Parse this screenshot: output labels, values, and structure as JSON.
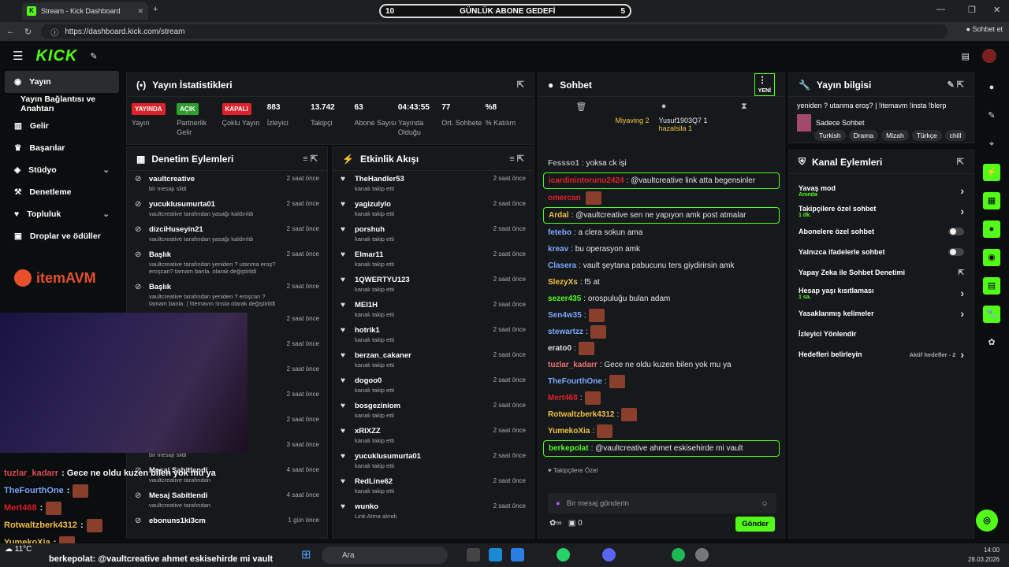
{
  "browser": {
    "tab_title": "Stream - Kick Dashboard",
    "url": "https://dashboard.kick.com/stream",
    "copilot": "Sohbet et"
  },
  "goal": {
    "left": "10",
    "title": "GÜNLÜK ABONE GEDEFİ",
    "right": "5"
  },
  "sidebar": {
    "items": [
      {
        "label": "Yayın"
      },
      {
        "label": "Yayın Bağlantısı ve Anahtarı"
      },
      {
        "label": "Gelir"
      },
      {
        "label": "Başarılar"
      },
      {
        "label": "Stüdyo"
      },
      {
        "label": "Denetleme"
      },
      {
        "label": "Topluluk"
      },
      {
        "label": "Droplar ve ödüller"
      }
    ],
    "brand": "itemAVM"
  },
  "stats": {
    "title": "Yayın İstatistikleri",
    "items": [
      {
        "value": "YAYINDA",
        "label": "Yayın",
        "color": "#e0202a"
      },
      {
        "value": "AÇIK",
        "label": "Partnerlik Gelir",
        "color": "#2e9e2e"
      },
      {
        "value": "KAPALI",
        "label": "Çoklu Yayın",
        "color": "#e0202a"
      },
      {
        "value": "883",
        "label": "İzleyici"
      },
      {
        "value": "13.742",
        "label": "Takipçi"
      },
      {
        "value": "63",
        "label": "Abone Sayısı"
      },
      {
        "value": "04:43:55",
        "label": "Yayında Olduğu"
      },
      {
        "value": "77",
        "label": "Ort. Sohbete"
      },
      {
        "value": "%8",
        "label": "% Katılım"
      }
    ]
  },
  "moderation": {
    "title": "Denetim Eylemleri",
    "rows": [
      {
        "name": "vaultcreative",
        "desc": "bir mesajı sildi",
        "time": "2 saat önce"
      },
      {
        "name": "yucuklusumurta01",
        "desc": "vaultcreative tarafından yasağı kaldırıldı",
        "time": "2 saat önce"
      },
      {
        "name": "dizciHuseyin21",
        "desc": "vaultcreative tarafından yasağı kaldırıldı",
        "time": "2 saat önce"
      },
      {
        "name": "Başlık",
        "desc": "vaultcreative tarafından yeniden ? utanma eroş? eroşcan? tamam banla. olarak değiştirildi",
        "time": "2 saat önce"
      },
      {
        "name": "Başlık",
        "desc": "vaultcreative tarafından yeniden ? eroşcan ? tamam banla. | !itemavm !insta olarak değiştirildi",
        "time": "2 saat önce"
      },
      {
        "name": "",
        "desc": "ıldı",
        "time": "2 saat önce"
      },
      {
        "name": "",
        "desc": "ıldı",
        "time": "2 saat önce"
      },
      {
        "name": "",
        "desc": "eliğine sohbetten",
        "time": "2 saat önce"
      },
      {
        "name": "",
        "desc": "ıldı",
        "time": "2 saat önce"
      },
      {
        "name": "",
        "desc": "ıldı",
        "time": "2 saat önce"
      },
      {
        "name": "vaultcreative",
        "desc": "bir mesajı sildi",
        "time": "3 saat önce"
      },
      {
        "name": "Mesaj Sabitlendi",
        "desc": "vaultcreative tarafından",
        "time": "4 saat önce"
      },
      {
        "name": "Mesaj Sabitlendi",
        "desc": "vaultcreative tarafından",
        "time": "4 saat önce"
      },
      {
        "name": "ebonuns1ki3cm",
        "desc": "",
        "time": "1 gün önce"
      }
    ]
  },
  "activity": {
    "title": "Etkinlik Akışı",
    "rows": [
      {
        "name": "TheHandler53",
        "desc": "kanalı takip etti",
        "time": "2 saat önce"
      },
      {
        "name": "yagizulylo",
        "desc": "kanalı takip etti",
        "time": "2 saat önce"
      },
      {
        "name": "porshuh",
        "desc": "kanalı takip etti",
        "time": "2 saat önce"
      },
      {
        "name": "Elmar11",
        "desc": "kanalı takip etti",
        "time": "2 saat önce"
      },
      {
        "name": "1QWERTYU123",
        "desc": "kanalı takip etti",
        "time": "2 saat önce"
      },
      {
        "name": "MEI1H",
        "desc": "kanalı takip etti",
        "time": "2 saat önce"
      },
      {
        "name": "hotrik1",
        "desc": "kanalı takip etti",
        "time": "2 saat önce"
      },
      {
        "name": "berzan_cakaner",
        "desc": "kanalı takip etti",
        "time": "2 saat önce"
      },
      {
        "name": "dogoo0",
        "desc": "kanalı takip etti",
        "time": "2 saat önce"
      },
      {
        "name": "bosgeziniom",
        "desc": "kanalı takip etti",
        "time": "2 saat önce"
      },
      {
        "name": "xRIXZZ",
        "desc": "kanalı takip etti",
        "time": "2 saat önce"
      },
      {
        "name": "yucuklusumurta01",
        "desc": "kanalı takip etti",
        "time": "2 saat önce"
      },
      {
        "name": "RedLine62",
        "desc": "kanalı takip etti",
        "time": "2 saat önce"
      },
      {
        "name": "wunko",
        "desc": "Link Atma alındı",
        "time": "2 saat önce"
      }
    ]
  },
  "chat": {
    "title": "Sohbet",
    "new": "YENİ",
    "leader1": "Miyaving",
    "leader1b": "2",
    "leader2": "Yusuf1903Q7",
    "leader2b": "1",
    "leader3": "hazalsila",
    "leader3b": "1",
    "messages": [
      {
        "user": "Fessso1",
        "text": ": yoksa ck işi",
        "color": "#aaa"
      },
      {
        "user": "icardinintorunu2424",
        "text": ": @vaultcreative link atta begensinler",
        "color": "#e0202a",
        "hl": true
      },
      {
        "user": "omercan",
        "text": "",
        "color": "#e0202a",
        "emote": true
      },
      {
        "user": "Ardal",
        "text": ": @vaultcreative sen ne yapıyon amk post atmalar",
        "color": "#f0c040",
        "hl": true
      },
      {
        "user": "fetebo",
        "text": ": a     clera sokun ama",
        "color": "#7aa8ff"
      },
      {
        "user": "kreav",
        "text": ": bu     operasyon amk",
        "color": "#7aa8ff"
      },
      {
        "user": "Clasera",
        "text": ": vault şeytana pabucunu ters giydirirsin amk",
        "color": "#7aa8ff"
      },
      {
        "user": "SlezyXs",
        "text": ": f5 at",
        "color": "#f0c040"
      },
      {
        "user": "sezer435",
        "text": ": orospuluğu bulan adam",
        "color": "#53fc18"
      },
      {
        "user": "Sen4w35",
        "text": ":",
        "color": "#7aa8ff",
        "emote": true
      },
      {
        "user": "stewartzz",
        "text": ":",
        "color": "#7aa8ff",
        "emote": true
      },
      {
        "user": "erato0",
        "text": ":",
        "color": "#ddd",
        "emote": true
      },
      {
        "user": "tuzlar_kadarr",
        "text": ": Gece ne oldu kuzen bilen yok mu ya",
        "color": "#f07070"
      },
      {
        "user": "TheFourthOne",
        "text": ":",
        "color": "#7aa8ff",
        "emote": true
      },
      {
        "user": "Mert468",
        "text": ":",
        "color": "#e0202a",
        "emote": true
      },
      {
        "user": "Rotwaltzberk4312",
        "text": ":",
        "color": "#f0c040",
        "emote": true
      },
      {
        "user": "YumekoXia",
        "text": ":",
        "color": "#f0c040",
        "emote": true
      },
      {
        "user": "berkepolat",
        "text": ": @vaultcreative ahmet eskisehirde mi vault",
        "color": "#53fc18",
        "hl": true
      }
    ],
    "followers_only": "Takipçilere Özel",
    "input_placeholder": "Bir mesaj gönderin",
    "count": "0",
    "send": "Gönder"
  },
  "info": {
    "title": "Yayın bilgisi",
    "stream_title": "yeniden ? utanma eroş? | !itemavm !insta !blerp",
    "category": "Sadece Sohbet",
    "tags": [
      "Turkish",
      "Drama",
      "Mizah",
      "Türkçe",
      "chill"
    ]
  },
  "channel": {
    "title": "Kanal Eylemleri",
    "options": [
      {
        "label": "Yavaş mod",
        "sub": "Anında"
      },
      {
        "label": "Takipçilere özel sohbet",
        "sub": "1 dk."
      },
      {
        "label": "Abonelere özel sohbet",
        "sub": ""
      },
      {
        "label": "Yalnızca ifadelerle sohbet",
        "sub": ""
      },
      {
        "label": "Yapay Zeka ile Sohbet Denetimi",
        "sub": ""
      },
      {
        "label": "Hesap yaşı kısıtlaması",
        "sub": "1 sa."
      },
      {
        "label": "Yasaklanmış kelimeler",
        "sub": ""
      },
      {
        "label": "İzleyici Yönlendir",
        "sub": ""
      },
      {
        "label": "Hedefleri belirleyin",
        "sub": ""
      }
    ],
    "goals_active": "Aktif hedefler - 2"
  },
  "overlay": [
    {
      "user": "tuzlar_kadarr",
      "text": ": Gece ne oldu kuzen bilen yok mu ya",
      "color": "#e0505a"
    },
    {
      "user": "TheFourthOne",
      "text": ":",
      "color": "#7aa8ff"
    },
    {
      "user": "Mert468",
      "text": ":",
      "color": "#e0202a"
    },
    {
      "user": "Rotwaltzberk4312",
      "text": ":",
      "color": "#f0c040"
    },
    {
      "user": "YumekoXia",
      "text": ":",
      "color": "#f0c040"
    }
  ],
  "overlay_last": {
    "user": "berkepolat",
    "text": "@vaultcreative ahmet eskisehirde mi vault"
  },
  "taskbar": {
    "search": "Ara",
    "time": "14:00",
    "date": "28.03.2026",
    "temp": "11°C"
  }
}
